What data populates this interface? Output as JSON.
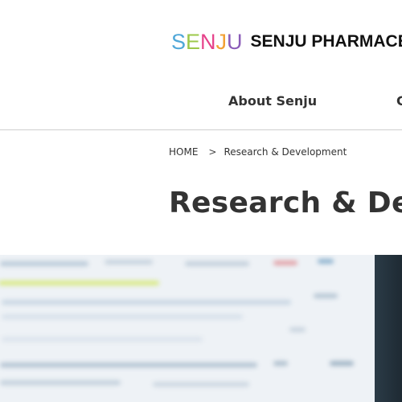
{
  "header": {
    "logo_mark": [
      "S",
      "E",
      "N",
      "J",
      "U"
    ],
    "logo_text": "SENJU PHARMACE",
    "nav": [
      {
        "label": "About Senju"
      },
      {
        "label": "C"
      }
    ]
  },
  "breadcrumb": {
    "home": "HOME",
    "separator": ">",
    "current": "Research & Development"
  },
  "page": {
    "title": "Research & Deve"
  },
  "colors": {
    "text": "#333333",
    "logo_s": "#4fa7d8",
    "logo_e": "#9cc84a",
    "logo_n": "#e6428a",
    "logo_j": "#f2a033",
    "logo_u": "#8a5bb8",
    "divider": "#cfcfcf"
  }
}
